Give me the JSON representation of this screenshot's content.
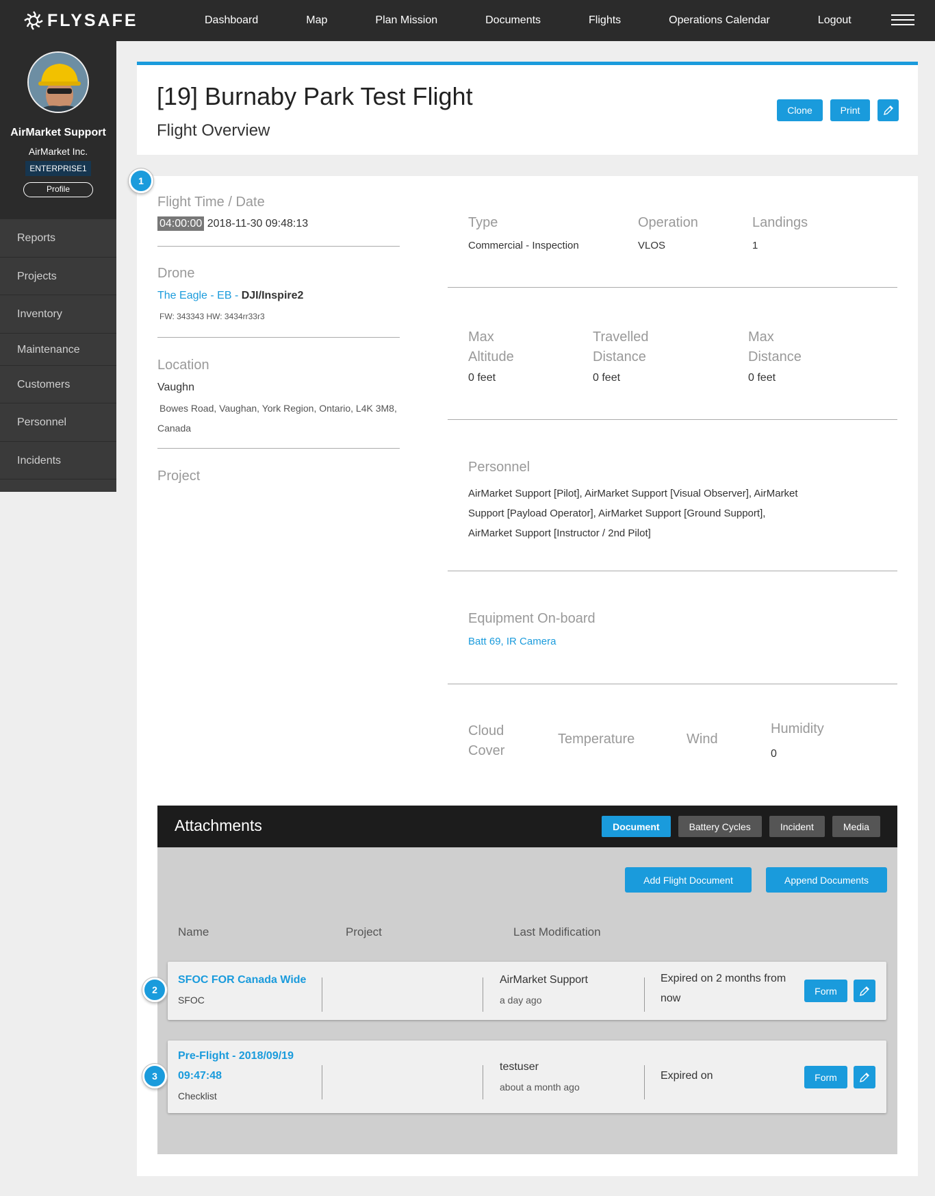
{
  "nav": {
    "brand": "FLYSAFE",
    "items": [
      "Dashboard",
      "Map",
      "Plan Mission",
      "Documents",
      "Flights",
      "Operations Calendar",
      "Logout"
    ]
  },
  "sidebar": {
    "user_name": "AirMarket Support",
    "org": "AirMarket Inc.",
    "plan_badge": "ENTERPRISE1",
    "profile_button": "Profile",
    "items": [
      "Reports",
      "Projects",
      "Inventory",
      "Maintenance",
      "Customers",
      "Personnel",
      "Incidents"
    ]
  },
  "header": {
    "title": "[19] Burnaby Park Test Flight",
    "subtitle": "Flight Overview",
    "clone_label": "Clone",
    "print_label": "Print"
  },
  "badges": [
    "1",
    "2",
    "3"
  ],
  "details": {
    "flight_time_label": "Flight Time / Date",
    "flight_duration": "04:00:00",
    "flight_datetime": "2018-11-30 09:48:13",
    "drone_label": "Drone",
    "drone_name": "The Eagle - EB",
    "drone_sep": " - ",
    "drone_model": "DJI/Inspire2",
    "drone_fw": "FW: 343343 HW: 3434rr33r3",
    "location_label": "Location",
    "location_name": "Vaughn",
    "location_address_1": "Bowes Road, Vaughan, York Region, Ontario, L4K 3M8,",
    "location_address_2": "Canada",
    "project_label": "Project",
    "type_label": "Type",
    "type_value": "Commercial - Inspection",
    "operation_label": "Operation",
    "operation_value": "VLOS",
    "landings_label": "Landings",
    "landings_value": "1",
    "max_alt_label_1": "Max",
    "max_alt_label_2": "Altitude",
    "max_alt_value": "0 feet",
    "travelled_label_1": "Travelled",
    "travelled_label_2": "Distance",
    "travelled_value": "0 feet",
    "max_dist_label_1": "Max",
    "max_dist_label_2": "Distance",
    "max_dist_value": "0 feet",
    "personnel_label": "Personnel",
    "personnel_line_1": "AirMarket Support [Pilot], AirMarket Support [Visual Observer], AirMarket",
    "personnel_line_2": "Support [Payload Operator], AirMarket Support [Ground Support],",
    "personnel_line_3": "AirMarket Support [Instructor / 2nd Pilot]",
    "equipment_label": "Equipment On-board",
    "equipment_1": "Batt 69",
    "equipment_sep": ", ",
    "equipment_2": "IR Camera",
    "cloud_label_1": "Cloud",
    "cloud_label_2": "Cover",
    "temperature_label": "Temperature",
    "wind_label": "Wind",
    "humidity_label": "Humidity",
    "humidity_value": "0"
  },
  "attachments": {
    "title": "Attachments",
    "tabs": [
      "Document",
      "Battery Cycles",
      "Incident",
      "Media"
    ],
    "add_button": "Add Flight Document",
    "append_button": "Append Documents",
    "columns": [
      "Name",
      "Project",
      "Last Modification"
    ],
    "rows": [
      {
        "name": "SFOC FOR Canada Wide",
        "type": "SFOC",
        "user": "AirMarket Support",
        "ago": "a day ago",
        "expiry_1": "Expired on 2 months from",
        "expiry_2": "now",
        "form_label": "Form"
      },
      {
        "name_1": "Pre-Flight - 2018/09/19",
        "name_2": "09:47:48",
        "type": "Checklist",
        "user": "testuser",
        "ago": "about a month ago",
        "expiry_1": "Expired on",
        "form_label": "Form"
      }
    ]
  },
  "colors": {
    "accent": "#1a9bdc",
    "topbar": "#2b2b2b",
    "sidebar": "#3a3a3a",
    "attachments_header": "#1c1c1c",
    "attachments_body": "#cfcfcf"
  }
}
